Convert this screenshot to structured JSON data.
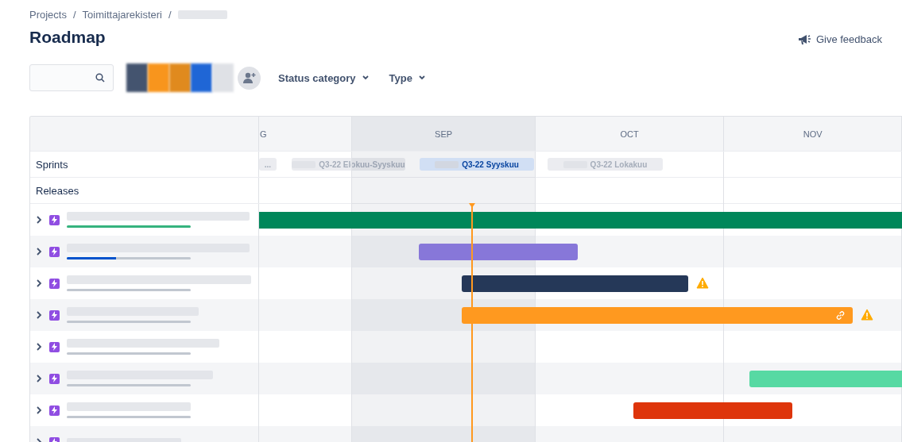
{
  "breadcrumbs": [
    {
      "text": "Projects",
      "separator": "/"
    },
    {
      "text": "Toimittajarekisteri",
      "separator": "/"
    }
  ],
  "title": "Roadmap",
  "feedback": {
    "label": "Give feedback"
  },
  "toolbar": {
    "avatars": [
      {
        "color": "#44546f"
      },
      {
        "color": "#f8951d"
      },
      {
        "color": "#e08a1e"
      },
      {
        "color": "#1f66d6"
      },
      {
        "color": "#dfe1e6"
      }
    ],
    "filters": [
      "Status category",
      "Type"
    ]
  },
  "timeline": {
    "months": [
      {
        "label": "G",
        "current": false
      },
      {
        "label": "SEP",
        "current": true
      },
      {
        "label": "OCT",
        "current": false
      },
      {
        "label": "NOV",
        "current": false
      }
    ]
  },
  "sprints": {
    "label": "Sprints",
    "items": [
      {
        "name": "...",
        "active": false
      },
      {
        "name": "Q3-22 Elokuu-Syyskuu",
        "active": false
      },
      {
        "name": "Q3-22 Syyskuu",
        "active": true
      },
      {
        "name": "Q3-22 Lokakuu",
        "active": false
      }
    ]
  },
  "releases": {
    "label": "Releases"
  },
  "epics": [
    {
      "kind": "epic",
      "level": 1,
      "bar": {
        "color": "#00875a"
      },
      "linked": false,
      "warning": false
    },
    {
      "kind": "epic",
      "level": 0.4,
      "bar": {
        "color": "#8777d9"
      },
      "linked": false,
      "warning": false
    },
    {
      "kind": "epic",
      "level": 0,
      "bar": {
        "color": "#253858"
      },
      "linked": false,
      "warning": true
    },
    {
      "kind": "epic",
      "level": 0,
      "bar": {
        "color": "#ff991f"
      },
      "linked": true,
      "warning": true
    },
    {
      "kind": "epic",
      "level": 0
    },
    {
      "kind": "epic",
      "level": 0,
      "bar": {
        "color": "#57d9a3"
      },
      "linked": false,
      "warning": false
    },
    {
      "kind": "epic",
      "level": 0,
      "bar": {
        "color": "#de350b"
      },
      "linked": false,
      "warning": false
    },
    {
      "kind": "epic"
    }
  ]
}
